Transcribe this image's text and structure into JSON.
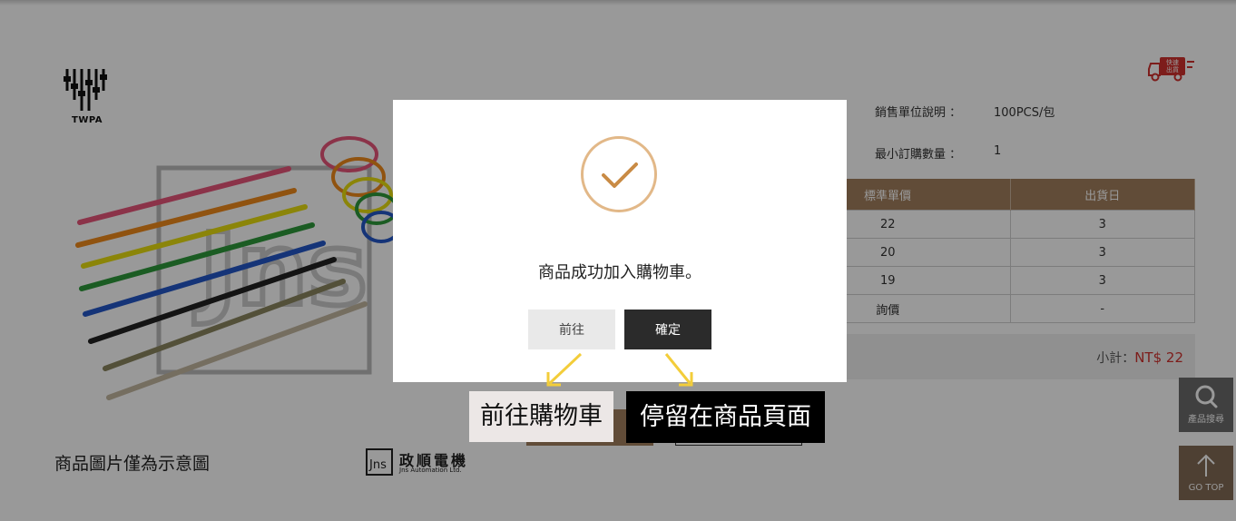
{
  "brand": {
    "logo_text": "TWPA"
  },
  "product": {
    "image_note": "商品圖片僅為示意圖",
    "maker_name": "政順電機",
    "maker_sub": "Jns Automation Ltd.",
    "watermark": "Jns"
  },
  "badges": {
    "truck_text_1": "快速",
    "truck_text_2": "出貨"
  },
  "info": {
    "sales_unit_label": "銷售單位說明 ：",
    "sales_unit_value": "100PCS/包",
    "min_order_label": "最小訂購數量 ：",
    "min_order_value": "1"
  },
  "price_table": {
    "headers": [
      "標準單價",
      "出貨日"
    ],
    "rows": [
      [
        "22",
        "3"
      ],
      [
        "20",
        "3"
      ],
      [
        "19",
        "3"
      ],
      [
        "詢價",
        "-"
      ]
    ]
  },
  "subtotal": {
    "label": "小計：",
    "amount": "NT$ 22"
  },
  "side": {
    "search_label": "產品搜尋",
    "top_label": "GO TOP"
  },
  "modal": {
    "message": "商品成功加入購物車。",
    "goto_button": "前往",
    "confirm_button": "確定"
  },
  "annotations": {
    "left": "前往購物車",
    "right": "停留在商品頁面"
  },
  "colors": {
    "accent_brown": "#a27f5e",
    "check_gold": "#e2b888",
    "price_red": "#d0312d",
    "dark_button": "#2b2b2b"
  }
}
